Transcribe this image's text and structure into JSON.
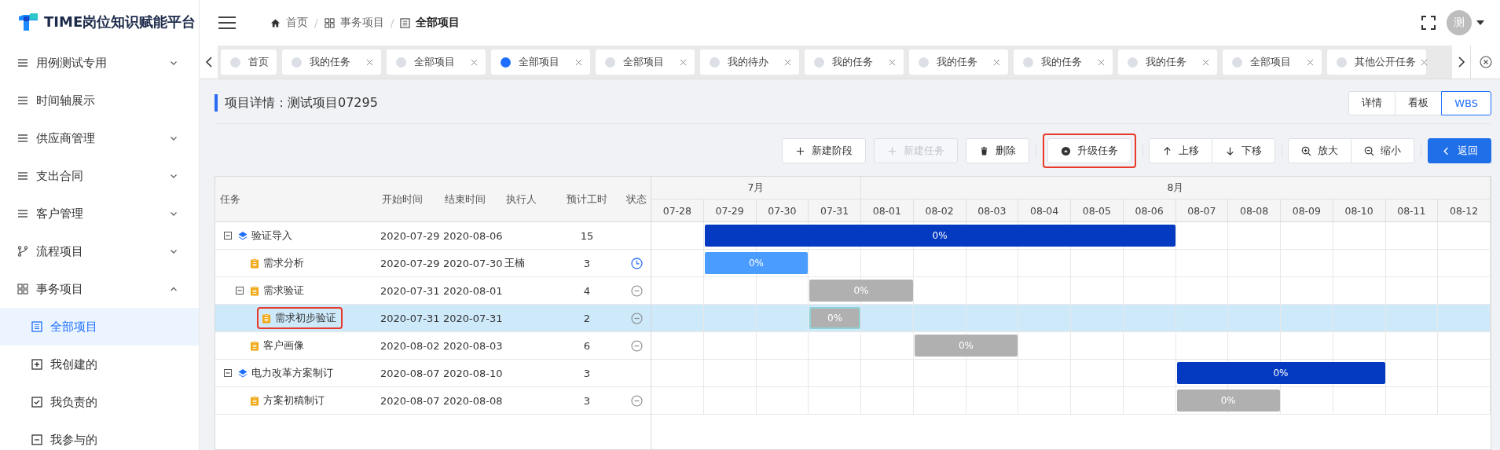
{
  "sidebar": {
    "logo": "TIME岗位知识赋能平台",
    "items": [
      {
        "label": "用例测试专用",
        "kind": "list",
        "expanded": false
      },
      {
        "label": "时间轴展示",
        "kind": "list"
      },
      {
        "label": "供应商管理",
        "kind": "list",
        "expanded": false
      },
      {
        "label": "支出合同",
        "kind": "list",
        "expanded": false
      },
      {
        "label": "客户管理",
        "kind": "list",
        "expanded": false
      },
      {
        "label": "流程项目",
        "kind": "branch",
        "expanded": false
      },
      {
        "label": "事务项目",
        "kind": "grid",
        "expanded": true,
        "children": [
          {
            "label": "全部项目",
            "kind": "table",
            "selected": true
          },
          {
            "label": "我创建的",
            "kind": "plus",
            "selected": false
          },
          {
            "label": "我负责的",
            "kind": "check",
            "selected": false
          },
          {
            "label": "我参与的",
            "kind": "box",
            "selected": false
          }
        ]
      }
    ]
  },
  "header": {
    "breadcrumb": [
      {
        "label": "首页",
        "kind": "home",
        "current": false
      },
      {
        "label": "事务项目",
        "kind": "grid",
        "current": false,
        "separator": "/"
      },
      {
        "label": "全部项目",
        "kind": "table",
        "current": true,
        "separator": "/"
      }
    ],
    "avatar": "测"
  },
  "tabs": [
    {
      "label": "首页",
      "selected": false,
      "closable": false
    },
    {
      "label": "我的任务",
      "selected": false,
      "closable": true
    },
    {
      "label": "全部项目",
      "selected": false,
      "closable": true
    },
    {
      "label": "全部项目",
      "selected": true,
      "closable": true
    },
    {
      "label": "全部项目",
      "selected": false,
      "closable": true
    },
    {
      "label": "我的待办",
      "selected": false,
      "closable": true
    },
    {
      "label": "我的任务",
      "selected": false,
      "closable": true
    },
    {
      "label": "我的任务",
      "selected": false,
      "closable": true
    },
    {
      "label": "我的任务",
      "selected": false,
      "closable": true
    },
    {
      "label": "我的任务",
      "selected": false,
      "closable": true
    },
    {
      "label": "全部项目",
      "selected": false,
      "closable": true
    },
    {
      "label": "其他公开任务",
      "selected": false,
      "closable": true
    }
  ],
  "page": {
    "title": "项目详情：测试项目07295",
    "views": [
      {
        "label": "详情",
        "selected": false
      },
      {
        "label": "看板",
        "selected": false
      },
      {
        "label": "WBS",
        "selected": true
      }
    ]
  },
  "toolbar": [
    {
      "joined": false,
      "buttons": [
        {
          "label": "新建阶段",
          "kind": "add",
          "disabled": false,
          "primary": false
        },
        {
          "label": "新建任务",
          "kind": "add",
          "disabled": true,
          "primary": false
        },
        {
          "label": "删除",
          "kind": "delete",
          "disabled": false,
          "primary": false
        }
      ]
    },
    {
      "joined": false,
      "buttons": [
        {
          "label": "升级任务",
          "kind": "upgrade",
          "disabled": false,
          "primary": false,
          "annotated": true
        }
      ]
    },
    {
      "joined": true,
      "buttons": [
        {
          "label": "上移",
          "kind": "up",
          "disabled": false,
          "primary": false
        },
        {
          "label": "下移",
          "kind": "down",
          "disabled": false,
          "primary": false
        }
      ]
    },
    {
      "joined": true,
      "buttons": [
        {
          "label": "放大",
          "kind": "zoom_in",
          "disabled": false,
          "primary": false
        },
        {
          "label": "缩小",
          "kind": "zoom_out",
          "disabled": false,
          "primary": false
        }
      ]
    },
    {
      "joined": false,
      "buttons": [
        {
          "label": "返回",
          "kind": "back",
          "disabled": false,
          "primary": true
        }
      ]
    }
  ],
  "table": {
    "columns": [
      "任务",
      "开始时间",
      "结束时间",
      "执行人",
      "预计工时",
      "状态"
    ],
    "rows": [
      {
        "task": "验证导入",
        "kind": "phase",
        "start": "2020-07-29",
        "end": "2020-08-06",
        "hours": "15",
        "progress": "0%",
        "expanded": true,
        "selected": false,
        "annotated": false,
        "children": [
          {
            "task": "需求分析",
            "kind": "active",
            "start": "2020-07-29",
            "end": "2020-07-30",
            "assignee": "王楠",
            "hours": "3",
            "progress": "0%",
            "selected": false,
            "annotated": false
          },
          {
            "task": "需求验证",
            "kind": "pending",
            "start": "2020-07-31",
            "end": "2020-08-01",
            "hours": "4",
            "progress": "0%",
            "expanded": true,
            "selected": false,
            "annotated": false,
            "children": [
              {
                "task": "需求初步验证",
                "kind": "pending",
                "start": "2020-07-31",
                "end": "2020-07-31",
                "hours": "2",
                "progress": "0%",
                "selected": true,
                "annotated": true
              }
            ]
          },
          {
            "task": "客户画像",
            "kind": "pending",
            "start": "2020-08-02",
            "end": "2020-08-03",
            "hours": "6",
            "progress": "0%",
            "selected": false,
            "annotated": false
          }
        ]
      },
      {
        "task": "电力改革方案制订",
        "kind": "phase",
        "start": "2020-08-07",
        "end": "2020-08-10",
        "hours": "3",
        "progress": "0%",
        "expanded": true,
        "selected": false,
        "annotated": false,
        "children": [
          {
            "task": "方案初稿制订",
            "kind": "pending",
            "start": "2020-08-07",
            "end": "2020-08-08",
            "hours": "3",
            "progress": "0%",
            "selected": false,
            "annotated": false
          }
        ]
      }
    ]
  },
  "gantt": {
    "months": [
      {
        "label": "7月",
        "days": [
          "07-28",
          "07-29",
          "07-30",
          "07-31"
        ]
      },
      {
        "label": "8月",
        "days": [
          "08-01",
          "08-02",
          "08-03",
          "08-04",
          "08-05",
          "08-06",
          "08-07",
          "08-08",
          "08-09",
          "08-10",
          "08-11",
          "08-12"
        ]
      }
    ]
  }
}
